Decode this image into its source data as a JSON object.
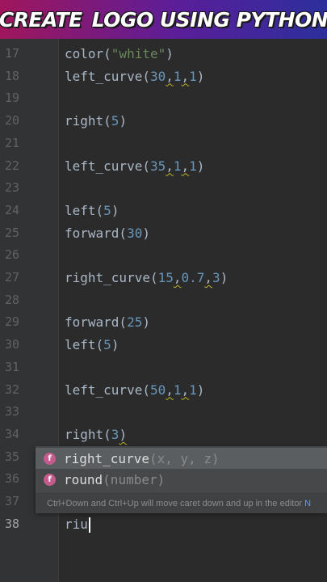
{
  "banner": {
    "text_left": "CREATE",
    "icon": "apple-logo-icon",
    "text_right": "LOGO USING PYTHON"
  },
  "editor": {
    "lines": [
      {
        "num": "17",
        "parts": [
          {
            "t": "color(",
            "c": "p"
          },
          {
            "t": "\"white\"",
            "c": "s"
          },
          {
            "t": ")",
            "c": "p"
          }
        ]
      },
      {
        "num": "18",
        "parts": [
          {
            "t": "left_curve(",
            "c": "p"
          },
          {
            "t": "30",
            "c": "n"
          },
          {
            "t": ",",
            "c": "q"
          },
          {
            "t": "1",
            "c": "n"
          },
          {
            "t": ",",
            "c": "q"
          },
          {
            "t": "1",
            "c": "n"
          },
          {
            "t": ")",
            "c": "p"
          }
        ]
      },
      {
        "num": "19",
        "parts": []
      },
      {
        "num": "20",
        "parts": [
          {
            "t": "right(",
            "c": "p"
          },
          {
            "t": "5",
            "c": "n"
          },
          {
            "t": ")",
            "c": "p"
          }
        ]
      },
      {
        "num": "21",
        "parts": []
      },
      {
        "num": "22",
        "parts": [
          {
            "t": "left_curve(",
            "c": "p"
          },
          {
            "t": "35",
            "c": "n"
          },
          {
            "t": ",",
            "c": "q"
          },
          {
            "t": "1",
            "c": "n"
          },
          {
            "t": ",",
            "c": "q"
          },
          {
            "t": "1",
            "c": "n"
          },
          {
            "t": ")",
            "c": "p"
          }
        ]
      },
      {
        "num": "23",
        "parts": []
      },
      {
        "num": "24",
        "parts": [
          {
            "t": "left(",
            "c": "p"
          },
          {
            "t": "5",
            "c": "n"
          },
          {
            "t": ")",
            "c": "p"
          }
        ]
      },
      {
        "num": "25",
        "parts": [
          {
            "t": "forward(",
            "c": "p"
          },
          {
            "t": "30",
            "c": "n"
          },
          {
            "t": ")",
            "c": "p"
          }
        ]
      },
      {
        "num": "26",
        "parts": []
      },
      {
        "num": "27",
        "parts": [
          {
            "t": "right_curve(",
            "c": "p"
          },
          {
            "t": "15",
            "c": "n"
          },
          {
            "t": ",",
            "c": "q"
          },
          {
            "t": "0.7",
            "c": "n"
          },
          {
            "t": ",",
            "c": "q"
          },
          {
            "t": "3",
            "c": "n"
          },
          {
            "t": ")",
            "c": "p"
          }
        ]
      },
      {
        "num": "28",
        "parts": []
      },
      {
        "num": "29",
        "parts": [
          {
            "t": "forward(",
            "c": "p"
          },
          {
            "t": "25",
            "c": "n"
          },
          {
            "t": ")",
            "c": "p"
          }
        ]
      },
      {
        "num": "30",
        "parts": [
          {
            "t": "left(",
            "c": "p"
          },
          {
            "t": "5",
            "c": "n"
          },
          {
            "t": ")",
            "c": "p"
          }
        ]
      },
      {
        "num": "31",
        "parts": []
      },
      {
        "num": "32",
        "parts": [
          {
            "t": "left_curve(",
            "c": "p"
          },
          {
            "t": "50",
            "c": "n"
          },
          {
            "t": ",",
            "c": "q"
          },
          {
            "t": "1",
            "c": "n"
          },
          {
            "t": ",",
            "c": "q"
          },
          {
            "t": "1",
            "c": "n"
          },
          {
            "t": ")",
            "c": "p"
          }
        ]
      },
      {
        "num": "33",
        "parts": []
      },
      {
        "num": "34",
        "parts": [
          {
            "t": "right(",
            "c": "p"
          },
          {
            "t": "3",
            "c": "n"
          },
          {
            "t": ")",
            "c": "q"
          }
        ]
      },
      {
        "num": "35",
        "parts": []
      },
      {
        "num": "36",
        "parts": []
      },
      {
        "num": "37",
        "parts": []
      },
      {
        "num": "38",
        "parts": [
          {
            "t": "riu",
            "c": "p"
          }
        ],
        "current": true
      }
    ]
  },
  "autocomplete": {
    "items": [
      {
        "badge": "f",
        "name": "right_curve",
        "args": "(x, y, z)",
        "selected": true
      },
      {
        "badge": "f",
        "name": "round",
        "args": "(number)",
        "selected": false
      }
    ],
    "hint": "Ctrl+Down and Ctrl+Up will move caret down and up in the editor",
    "hint_link": "N"
  },
  "colors": {
    "background": "#2b2b2b",
    "gutter": "#313335",
    "code_text": "#a9b7c6",
    "string": "#6a8759",
    "number": "#6897bb",
    "badge": "#c55a8d"
  }
}
